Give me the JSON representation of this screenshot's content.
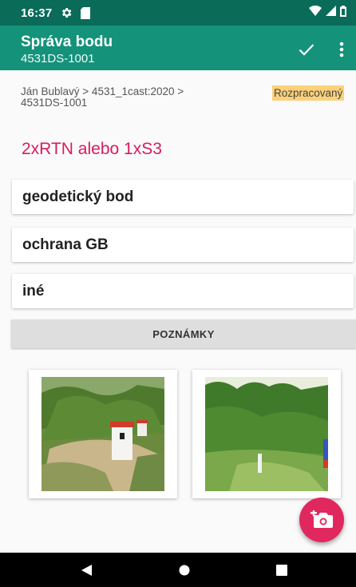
{
  "status_bar": {
    "time": "16:37"
  },
  "app_bar": {
    "title": "Správa bodu",
    "subtitle": "4531DS-1001"
  },
  "breadcrumb": {
    "text": "Ján Bublavý > 4531_1cast:2020 > 4531DS-1001"
  },
  "status_badge": {
    "label": "Rozpracovaný",
    "color": "#fbd179"
  },
  "method_text": "2xRTN alebo 1xS3",
  "fields": {
    "geodetic_point": "geodetický bod",
    "protection": "ochrana GB",
    "other": "iné"
  },
  "notes_button": {
    "label": "POZNÁMKY"
  },
  "photos": [
    {
      "icon": "photo-boundary-markers"
    },
    {
      "icon": "photo-vegetation-pole"
    }
  ],
  "colors": {
    "status_bar": "#0a6b58",
    "app_bar": "#14927a",
    "accent": "#d81b60",
    "fab": "#e0285f"
  },
  "icons": [
    "gear-icon",
    "sd-card-icon",
    "wifi-icon",
    "signal-icon",
    "battery-icon",
    "check-icon",
    "more-vert-icon",
    "add-photo-icon",
    "back-icon",
    "home-icon",
    "recents-icon"
  ]
}
